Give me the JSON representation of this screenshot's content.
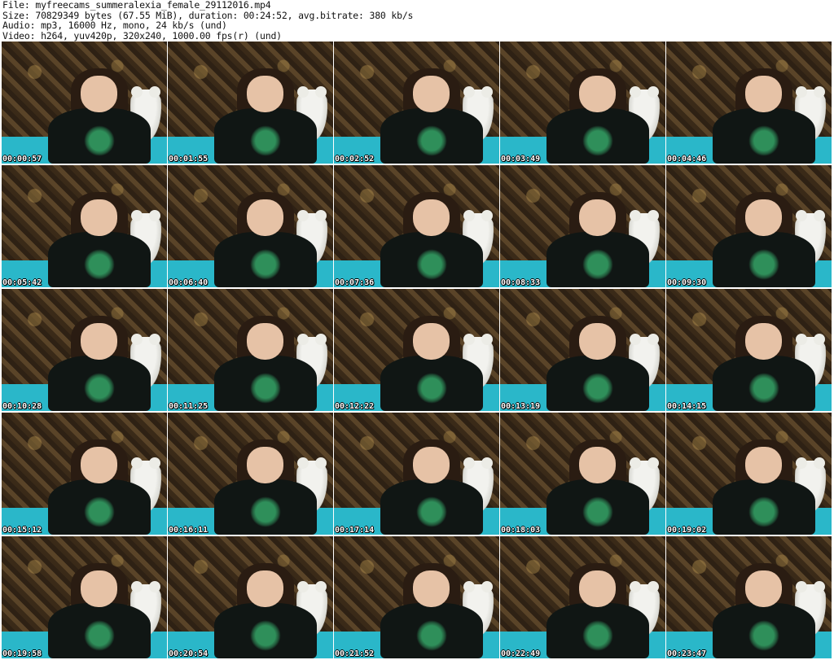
{
  "header": {
    "file": "File: myfreecams_summeralexia_female_29112016.mp4",
    "size": "Size: 70829349 bytes (67.55 MiB), duration: 00:24:52, avg.bitrate: 380 kb/s",
    "audio": "Audio: mp3, 16000 Hz, mono, 24 kb/s (und)",
    "video": "Video: h264, yuv420p, 320x240, 1000.00 fps(r) (und)"
  },
  "thumbnails": [
    {
      "timestamp": "00:00:57"
    },
    {
      "timestamp": "00:01:55"
    },
    {
      "timestamp": "00:02:52"
    },
    {
      "timestamp": "00:03:49"
    },
    {
      "timestamp": "00:04:46"
    },
    {
      "timestamp": "00:05:42"
    },
    {
      "timestamp": "00:06:40"
    },
    {
      "timestamp": "00:07:36"
    },
    {
      "timestamp": "00:08:33"
    },
    {
      "timestamp": "00:09:30"
    },
    {
      "timestamp": "00:10:28"
    },
    {
      "timestamp": "00:11:25"
    },
    {
      "timestamp": "00:12:22"
    },
    {
      "timestamp": "00:13:19"
    },
    {
      "timestamp": "00:14:15"
    },
    {
      "timestamp": "00:15:12"
    },
    {
      "timestamp": "00:16:11"
    },
    {
      "timestamp": "00:17:14"
    },
    {
      "timestamp": "00:18:03"
    },
    {
      "timestamp": "00:19:02"
    },
    {
      "timestamp": "00:19:58"
    },
    {
      "timestamp": "00:20:54"
    },
    {
      "timestamp": "00:21:52"
    },
    {
      "timestamp": "00:22:49"
    },
    {
      "timestamp": "00:23:47"
    }
  ],
  "colors": {
    "floor": "#2ab7c9",
    "hoodie": "#101614",
    "print": "#2f8f5a",
    "timestamp_text": "#ffffff"
  }
}
